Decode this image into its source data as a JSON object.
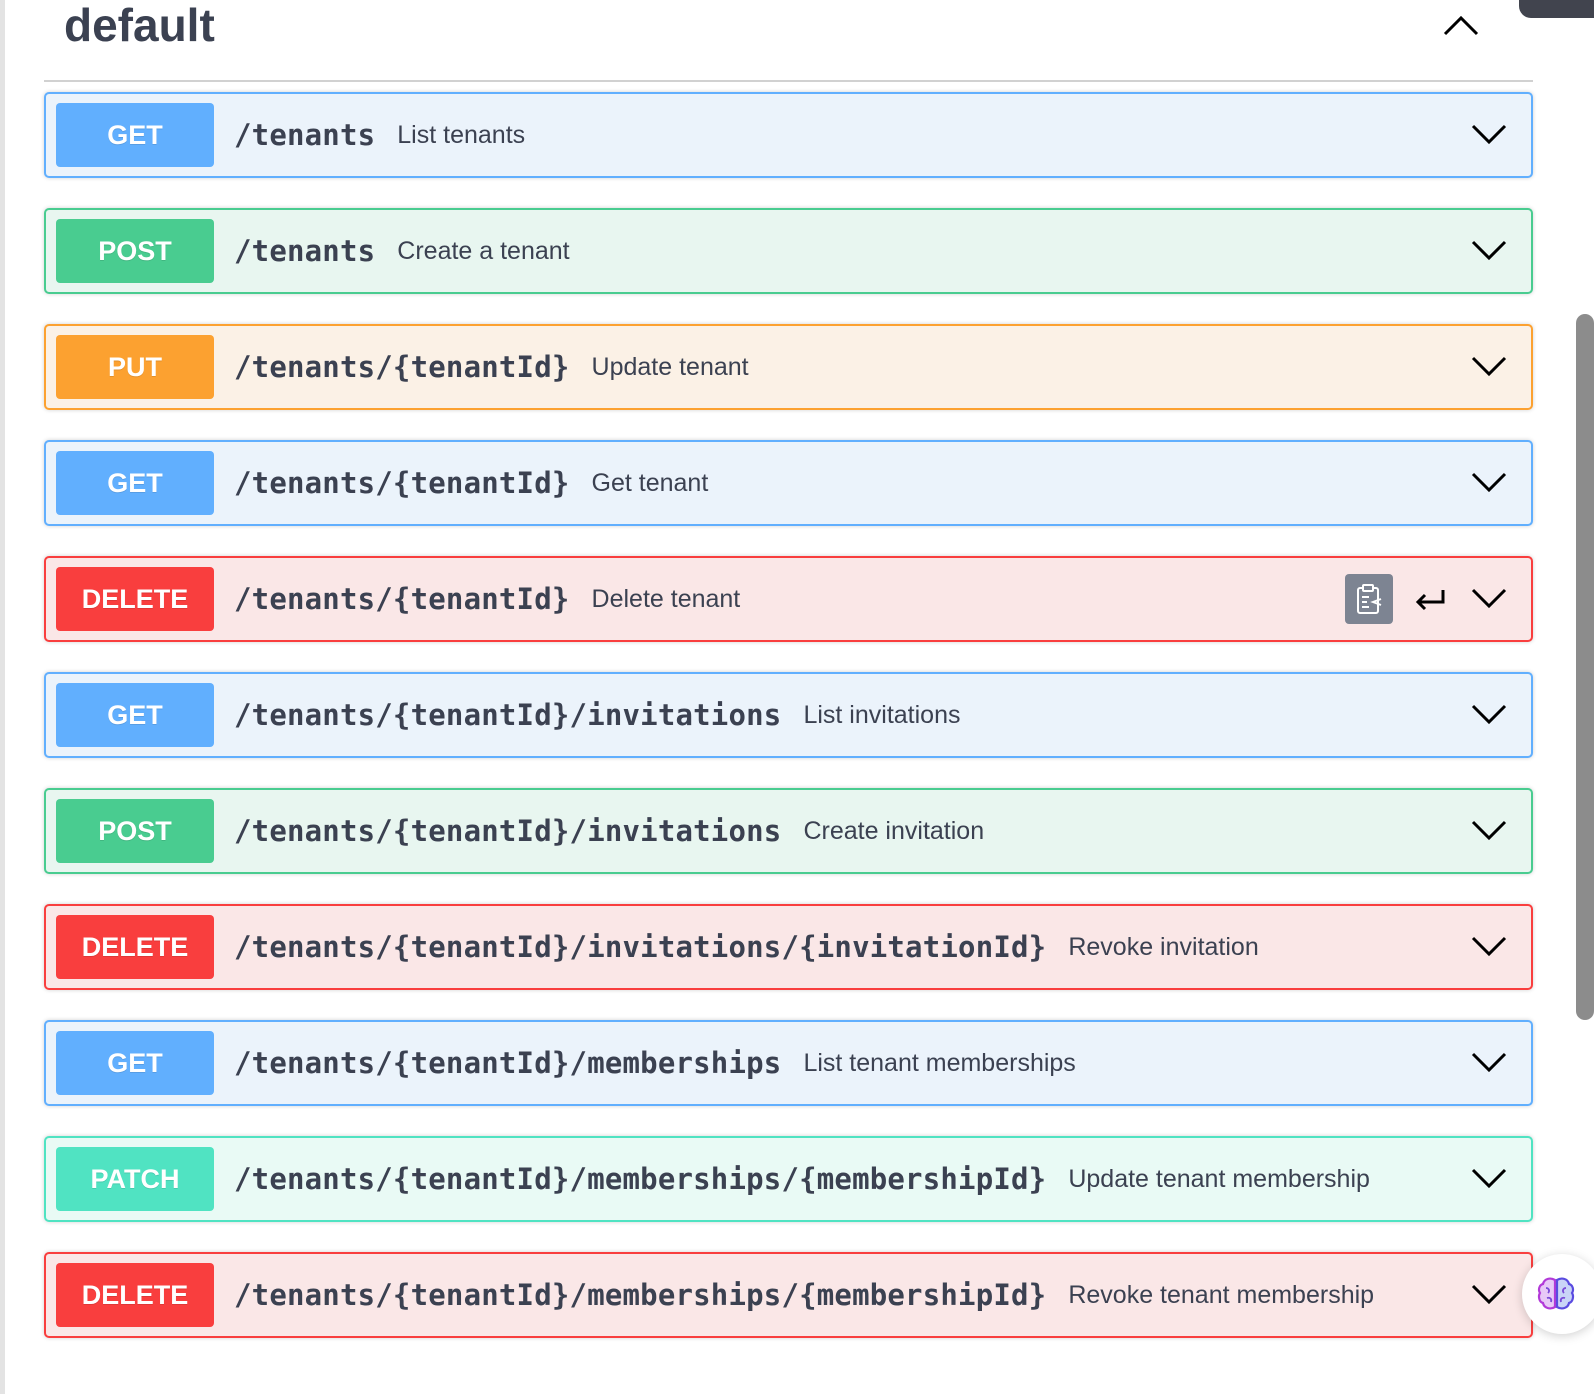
{
  "section": {
    "title": "default"
  },
  "operations": [
    {
      "method": "GET",
      "path": "/tenants",
      "summary": "List tenants"
    },
    {
      "method": "POST",
      "path": "/tenants",
      "summary": "Create a tenant"
    },
    {
      "method": "PUT",
      "path": "/tenants/{tenantId}",
      "summary": "Update tenant"
    },
    {
      "method": "GET",
      "path": "/tenants/{tenantId}",
      "summary": "Get tenant"
    },
    {
      "method": "DELETE",
      "path": "/tenants/{tenantId}",
      "summary": "Delete tenant"
    },
    {
      "method": "GET",
      "path": "/tenants/{tenantId}/invitations",
      "summary": "List invitations"
    },
    {
      "method": "POST",
      "path": "/tenants/{tenantId}/invitations",
      "summary": "Create invitation"
    },
    {
      "method": "DELETE",
      "path": "/tenants/{tenantId}/invitations/{invitationId}",
      "summary": "Revoke invitation"
    },
    {
      "method": "GET",
      "path": "/tenants/{tenantId}/memberships",
      "summary": "List tenant memberships"
    },
    {
      "method": "PATCH",
      "path": "/tenants/{tenantId}/memberships/{membershipId}",
      "summary": "Update tenant membership"
    },
    {
      "method": "DELETE",
      "path": "/tenants/{tenantId}/memberships/{membershipId}",
      "summary": "Revoke tenant membership"
    }
  ],
  "colors": {
    "get": "#61affe",
    "post": "#49cc90",
    "put": "#fca130",
    "delete": "#f93e3e",
    "patch": "#50e3c2",
    "text": "#3b4151"
  },
  "icons": {
    "section_toggle": "chevron-up-icon",
    "row_toggle": "chevron-down-icon",
    "copy": "clipboard-copy-icon",
    "enter": "enter-return-icon",
    "assistant": "brain-icon"
  }
}
